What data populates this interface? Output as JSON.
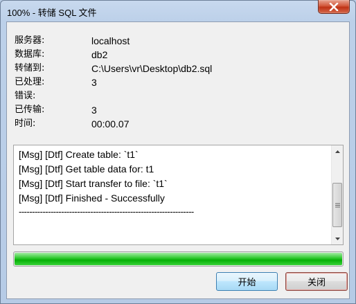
{
  "window": {
    "title": "100% - 转储 SQL 文件"
  },
  "info": [
    {
      "label": "服务器:",
      "value": "localhost"
    },
    {
      "label": "数据库:",
      "value": "db2"
    },
    {
      "label": "转储到:",
      "value": "C:\\Users\\vr\\Desktop\\db2.sql"
    },
    {
      "label": "已处理:",
      "value": "3"
    },
    {
      "label": "错误:",
      "value": ""
    },
    {
      "label": "已传输:",
      "value": "3"
    },
    {
      "label": "时间:",
      "value": "00:00.07"
    }
  ],
  "log": {
    "lines": [
      "[Msg] [Dtf] Create table: `t1`",
      "[Msg] [Dtf] Get table data for: t1",
      "[Msg] [Dtf] Start transfer to file: `t1`",
      "[Msg] [Dtf] Finished - Successfully",
      "------------------------------------------------------------------"
    ]
  },
  "progress": {
    "percent": 100,
    "color": "#06b006"
  },
  "buttons": {
    "start_label": "开始",
    "close_label": "关闭"
  },
  "icons": {
    "close": "close-icon",
    "scroll_up": "arrow-up-icon",
    "scroll_down": "arrow-down-icon",
    "thumb": "grip-icon"
  }
}
